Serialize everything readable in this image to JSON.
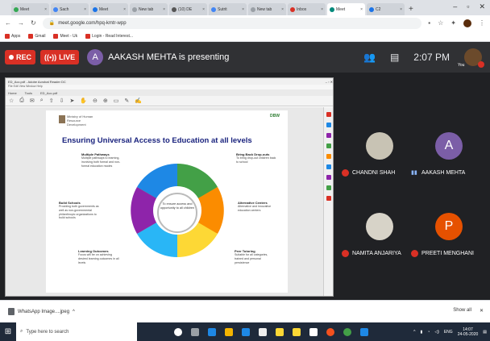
{
  "browser": {
    "tabs": [
      {
        "label": "Meet",
        "fav": "#34a853"
      },
      {
        "label": "Sach",
        "fav": "#4285f4"
      },
      {
        "label": "Meet",
        "fav": "#1a73e8"
      },
      {
        "label": "New tab",
        "fav": "#9aa0a6"
      },
      {
        "label": "(10) DE",
        "fav": "#555555"
      },
      {
        "label": "Sutrit",
        "fav": "#4285f4"
      },
      {
        "label": "New tab",
        "fav": "#9aa0a6"
      },
      {
        "label": "Inbox",
        "fav": "#d93025"
      },
      {
        "label": "Meet",
        "fav": "#00897b",
        "active": true
      },
      {
        "label": "C2",
        "fav": "#1a73e8"
      }
    ],
    "new_tab_label": "+",
    "window_controls": {
      "minimize": "–",
      "maximize": "▫",
      "close": "✕"
    },
    "address": {
      "url": "meet.google.com/hpq-kmtr-wpp"
    },
    "bookmarks": [
      {
        "label": "Apps"
      },
      {
        "label": "Gmail"
      },
      {
        "label": "Meet - Uk"
      },
      {
        "label": "Login - Read Interest..."
      }
    ]
  },
  "meet": {
    "rec_label": "REC",
    "live_label": "LIVE",
    "presenter_initial": "A",
    "presenting_text": "AAKASH MEHTA is presenting",
    "clock": "2:07 PM",
    "you_label": "You",
    "participants": [
      {
        "name": "CHANDNI SHAH",
        "initial": "",
        "face_color": "#c8c3b4",
        "status": "muted"
      },
      {
        "name": "AAKASH MEHTA",
        "initial": "A",
        "face_color": "#7b5ea7",
        "status": "speaking"
      },
      {
        "name": "NAMITA ANJARIYA",
        "initial": "",
        "face_color": "#d7d3c8",
        "status": "muted"
      },
      {
        "name": "PREETI MENGHANI",
        "initial": "P",
        "face_color": "#e65100",
        "status": "muted"
      }
    ]
  },
  "shared_screen": {
    "window_title": "ED_Acc.pdf - Adobe Acrobat Reader DC",
    "menu": "File  Edit  View  Window  Help",
    "tabs": [
      "Home",
      "Tools",
      "ED_Acc.pdf"
    ],
    "slide": {
      "logo_text": "Ministry of Human Resource Development",
      "badge": "DBW",
      "title": "Ensuring Universal Access to Education at all levels",
      "center_text": "To ensure access and opportunity to all children",
      "boxes": [
        {
          "heading": "Multiple Pathways",
          "text": "Multiple pathways to learning, involving both formal and non-formal education modes"
        },
        {
          "heading": "Bring Back Drop-outs",
          "text": "To bring drop-out children back to school"
        },
        {
          "heading": "Build Schools",
          "text": "Providing both governments as well as non-governmental philanthropic organizations to build schools"
        },
        {
          "heading": "Alternative Centers",
          "text": "Alternative and innovative education centers"
        },
        {
          "heading": "Learning Outcomes",
          "text": "Focus will be on achieving desired learning outcomes in all levels"
        },
        {
          "heading": "Peer Tutoring",
          "text": "Suitable for all categories, trained and personal persistence"
        }
      ]
    }
  },
  "downloads": {
    "file_name": "WhatsApp Image....jpeg",
    "show_all_label": "Show all",
    "close_label": "✕"
  },
  "taskbar": {
    "search_placeholder": "Type here to search",
    "tray_time": "14:07",
    "tray_date": "24-05-2020",
    "tray_lang": "ENG"
  },
  "colors": {
    "meet_bg": "#202124",
    "rec_red": "#d93025",
    "slide_title": "#1a237e"
  }
}
